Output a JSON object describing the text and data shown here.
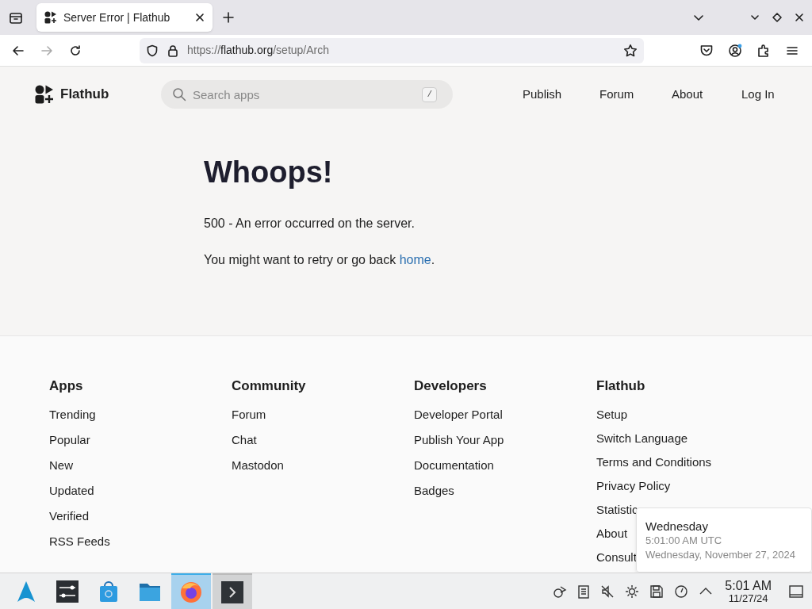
{
  "browser": {
    "tabs": [
      {
        "title": "Server Error | Flathub",
        "selected": true
      }
    ],
    "url": {
      "scheme": "https://",
      "host": "flathub.org",
      "path": "/setup/Arch"
    }
  },
  "header": {
    "brand": "Flathub",
    "search": {
      "placeholder": "Search apps",
      "shortcut": "/"
    },
    "nav": [
      "Publish",
      "Forum",
      "About",
      "Log In"
    ]
  },
  "error": {
    "title": "Whoops!",
    "message": "500 - An error occurred on the server.",
    "hint": "You might want to retry or go back",
    "link": "home",
    "after_link": "."
  },
  "footer": {
    "columns": [
      {
        "heading": "Apps",
        "links": [
          "Trending",
          "Popular",
          "New",
          "Updated",
          "Verified",
          "RSS Feeds"
        ]
      },
      {
        "heading": "Community",
        "links": [
          "Forum",
          "Chat",
          "Mastodon"
        ]
      },
      {
        "heading": "Developers",
        "links": [
          "Developer Portal",
          "Publish Your App",
          "Documentation",
          "Badges"
        ]
      },
      {
        "heading": "Flathub",
        "links": [
          "Setup",
          "Switch Language",
          "Terms and Conditions",
          "Privacy Policy",
          "Statistic",
          "About",
          "Consult"
        ]
      }
    ]
  },
  "tooltip": {
    "title": "Wednesday",
    "time": "5:01:00 AM UTC",
    "date": "Wednesday, November 27, 2024"
  },
  "taskbar": {
    "apps": [
      {
        "kind": "launcher",
        "selected": false,
        "running": false
      },
      {
        "kind": "settings",
        "selected": false,
        "running": false
      },
      {
        "kind": "store",
        "selected": false,
        "running": false
      },
      {
        "kind": "files",
        "selected": false,
        "running": false
      },
      {
        "kind": "firefox",
        "selected": true,
        "running": true
      },
      {
        "kind": "terminal",
        "selected": false,
        "running": true
      }
    ],
    "clock": {
      "time": "5:01 AM",
      "date": "11/27/24"
    }
  }
}
